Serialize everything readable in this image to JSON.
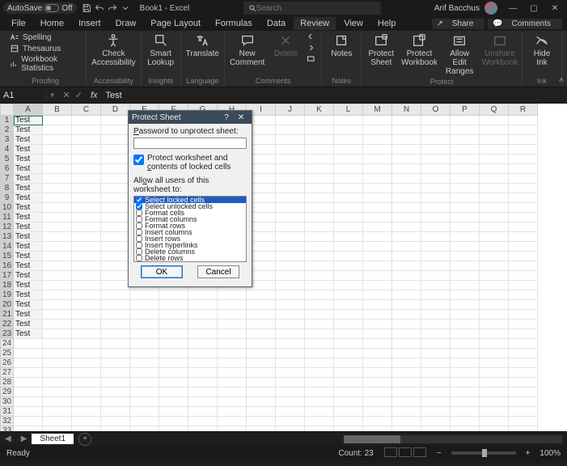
{
  "title": {
    "autosave_label": "AutoSave",
    "autosave_state": "Off",
    "doc": "Book1 - Excel",
    "search_placeholder": "Search",
    "user": "Arif Bacchus"
  },
  "tabs": {
    "file": "File",
    "home": "Home",
    "insert": "Insert",
    "draw": "Draw",
    "page_layout": "Page Layout",
    "formulas": "Formulas",
    "data": "Data",
    "review": "Review",
    "view": "View",
    "help": "Help",
    "share": "Share",
    "comments": "Comments"
  },
  "ribbon": {
    "proofing": {
      "spelling": "Spelling",
      "thesaurus": "Thesaurus",
      "stats": "Workbook Statistics",
      "label": "Proofing"
    },
    "accessibility": {
      "btn": "Check\nAccessibility",
      "label": "Accessibility"
    },
    "insights": {
      "btn": "Smart\nLookup",
      "label": "Insights"
    },
    "language": {
      "btn": "Translate",
      "label": "Language"
    },
    "comments": {
      "new": "New\nComment",
      "delete": "Delete",
      "notes": "Notes",
      "label": "Comments",
      "notes_label": "Notes"
    },
    "protect": {
      "sheet": "Protect\nSheet",
      "workbook": "Protect\nWorkbook",
      "ranges": "Allow Edit\nRanges",
      "unshare": "Unshare\nWorkbook",
      "label": "Protect"
    },
    "ink": {
      "hide": "Hide\nInk",
      "label": "Ink"
    }
  },
  "formula_bar": {
    "name": "A1",
    "value": "Test"
  },
  "columns": [
    "A",
    "B",
    "C",
    "D",
    "E",
    "F",
    "G",
    "H",
    "I",
    "J",
    "K",
    "L",
    "M",
    "N",
    "O",
    "P",
    "Q",
    "R"
  ],
  "cells": {
    "value": "Test",
    "filled_rows": 23,
    "total_rows": 35
  },
  "sheets": {
    "tab": "Sheet1"
  },
  "status": {
    "ready": "Ready",
    "count": "Count: 23",
    "zoom": "100%"
  },
  "dialog": {
    "title": "Protect Sheet",
    "pwd_label": "Password to unprotect sheet:",
    "protect_label": "Protect worksheet and contents of locked cells",
    "allow_label": "Allow all users of this worksheet to:",
    "perms": [
      "Select locked cells",
      "Select unlocked cells",
      "Format cells",
      "Format columns",
      "Format rows",
      "Insert columns",
      "Insert rows",
      "Insert hyperlinks",
      "Delete columns",
      "Delete rows"
    ],
    "ok": "OK",
    "cancel": "Cancel"
  }
}
